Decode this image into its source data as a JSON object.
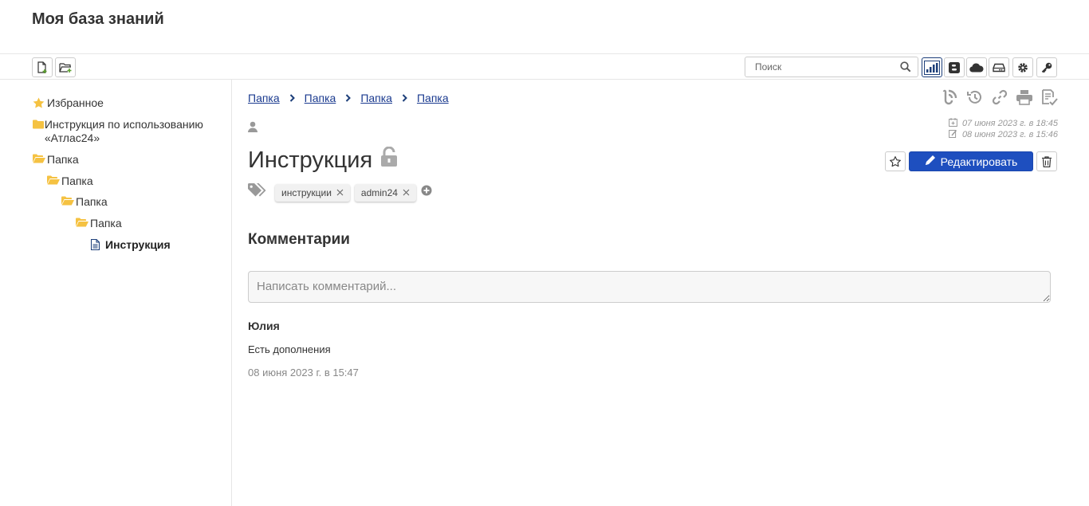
{
  "app": {
    "title": "Моя база знаний"
  },
  "toolbar": {
    "search_placeholder": "Поиск"
  },
  "sidebar": {
    "items": [
      {
        "label": "Избранное",
        "icon": "star-icon"
      },
      {
        "label": "Инструкция по использованию «Атлас24»",
        "icon": "folder-icon"
      },
      {
        "label": "Папка",
        "icon": "folder-open-icon"
      },
      {
        "label": "Папка",
        "icon": "folder-open-icon"
      },
      {
        "label": "Папка",
        "icon": "folder-open-icon"
      },
      {
        "label": "Папка",
        "icon": "folder-open-icon"
      },
      {
        "label": "Инструкция",
        "icon": "document-icon"
      }
    ]
  },
  "breadcrumbs": [
    "Папка",
    "Папка",
    "Папка",
    "Папка"
  ],
  "document": {
    "title": "Инструкция",
    "created": "07 июня 2023 г. в 18:45",
    "modified": "08 июня 2023 г. в 15:46",
    "edit_label": "Редактировать",
    "tags": [
      "инструкции",
      "admin24"
    ]
  },
  "comments": {
    "heading": "Комментарии",
    "placeholder": "Написать комментарий...",
    "items": [
      {
        "author": "Юлия",
        "text": "Есть дополнения",
        "date": "08 июня 2023 г. в 15:47"
      }
    ]
  },
  "colors": {
    "accent": "#1e4fbf",
    "link": "#1a3a8f",
    "folder": "#f5c242",
    "icon_gray": "#999999"
  }
}
